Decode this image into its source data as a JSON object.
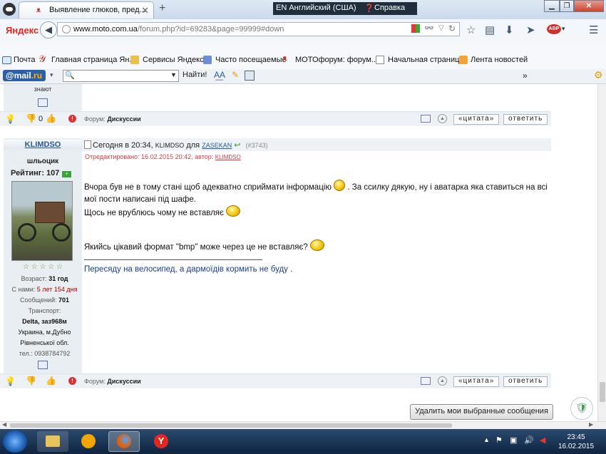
{
  "browser": {
    "tab_title": "Выявление глюков, пред...",
    "lang_indicator": "EN Английский (США)",
    "help": "Справка",
    "yandex_logo": "Яндекс",
    "url_domain": "www.moto.com.ua",
    "url_path": "/forum.php?id=69283&page=99999#down"
  },
  "bookmarks": [
    "Почта",
    "Главная страница Ян...",
    "Сервисы Яндекса",
    "Часто посещаемые",
    "МОТОфорум: форум...",
    "Начальная страница",
    "Лента новостей"
  ],
  "mailbar": {
    "logo_prefix": "@mail",
    "logo_suffix": ".ru",
    "search_placeholder": "",
    "find_label": "Найти!",
    "more": "»"
  },
  "prev_post": {
    "user_status_tail": "знают",
    "rating": "0",
    "forum_label": "Форум:",
    "forum_name": "Дискуссии",
    "quote_btn": "«цитата»",
    "reply_btn": "ответить"
  },
  "post": {
    "username": "KLIMDSO",
    "user_title": "шльоцик",
    "rating_label": "Рейтинг:",
    "rating_value": "107",
    "stars": "☆ ☆ ☆ ☆ ☆",
    "age_label": "Возраст:",
    "age_value": "31 год",
    "since_label": "С нами:",
    "since_value": "5 лет 154 дня",
    "messages_label": "Сообщений:",
    "messages_value": "701",
    "transport_label": "Транспорт:",
    "transport_value": "Delta, заз968м",
    "location_line1": "Украина, м.Дубно",
    "location_line2": "Рівненської обл.",
    "phone": "тел.: 0938784792",
    "header_time": "Сегодня в 20:34,",
    "header_author": "KLIMDSO",
    "header_for": "для",
    "header_to": "ZASEKAN",
    "header_num": "(#3743)",
    "edited_label": "Отредактировано: 16.02.2015 20:42, автор:",
    "edited_author": "KLIMDSO",
    "line1a": "Вчора був не в тому стані щоб адекватно сприймати інформацію",
    "line1b": ". За ссилку дякую, ну і аватарка яка ставиться на всі мої пости написані під шафе.",
    "line2": "Щось не врублюсь чому не вставляє",
    "line3": "Якийсь цікавий формат \"bmp\" може через це не вставляє?",
    "signature": "Пересяду на велосипед, а дармоїдів кормить не буду .",
    "forum_label": "Форум:",
    "forum_name": "Дискуссии",
    "quote_btn": "«цитата»",
    "reply_btn": "ответить"
  },
  "delete_selected": "Удалить мои выбранные сообщения",
  "taskbar": {
    "time": "23:45",
    "date": "16.02.2015"
  },
  "colors": {
    "link": "#2a5a9a",
    "edited": "#d04040",
    "signature": "#1a3d8f"
  }
}
